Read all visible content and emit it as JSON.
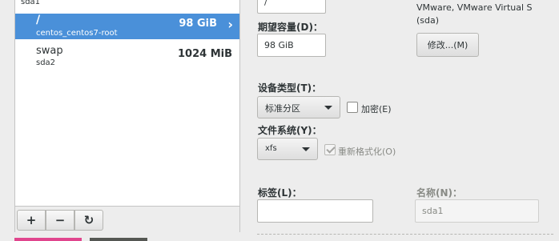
{
  "partition_list": {
    "partial_top_row": {
      "device": "sda1"
    },
    "rows": [
      {
        "mount": "/",
        "device": "centos_centos7-root",
        "size": "98 GiB",
        "selected": true
      },
      {
        "mount": "swap",
        "device": "sda2",
        "size": "1024 MiB",
        "selected": false
      }
    ],
    "toolbar": {
      "add_label": "+",
      "remove_label": "−",
      "refresh_label": "↻"
    }
  },
  "details": {
    "mount_point_value": "/",
    "capacity_label": "期望容量(D)：",
    "capacity_value": "98 GiB",
    "device_desc_line1": "VMware, VMware Virtual S",
    "device_desc_line2": "(sda)",
    "modify_button_label": "修改...(M)",
    "device_type_label": "设备类型(T)：",
    "device_type_value": "标准分区",
    "encrypt_label": "加密(E)",
    "filesystem_label": "文件系统(Y)：",
    "filesystem_value": "xfs",
    "reformat_label": "重新格式化(O)",
    "tag_label": "标签(L)：",
    "tag_value": "",
    "name_label": "名称(N)：",
    "name_value": "sda1"
  },
  "colors": {
    "selection": "#4a90d9",
    "accent_pink": "#e0458d"
  }
}
